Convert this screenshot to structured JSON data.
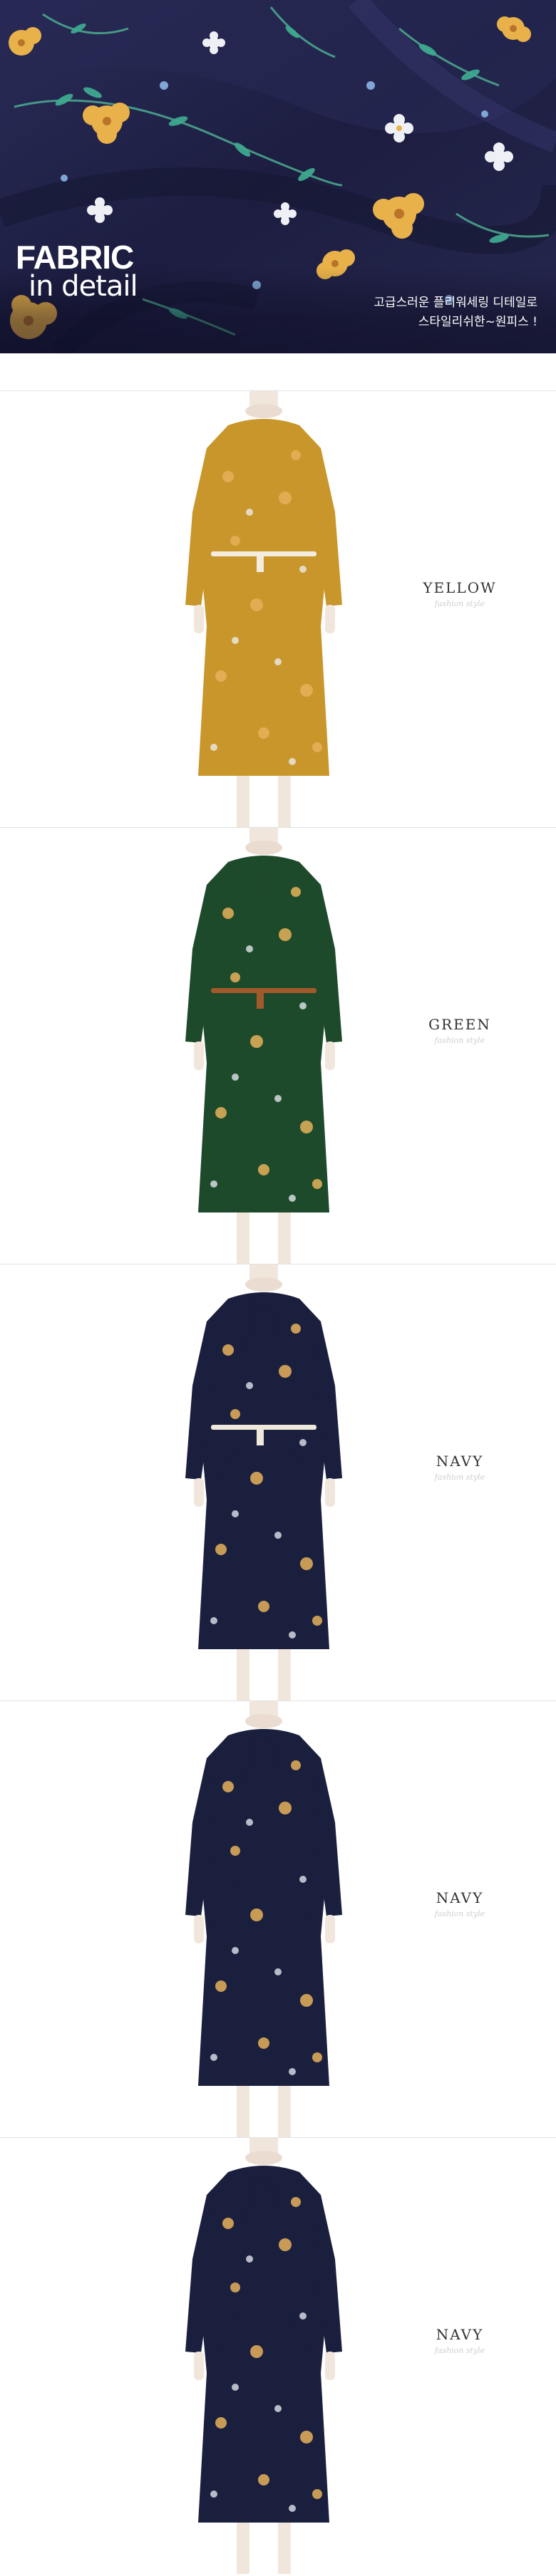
{
  "fabric": {
    "title_line1": "FABRIC",
    "title_line2": "in detail",
    "description": [
      "고급스러운 플리워세링 디테일로",
      "스타일리쉬한~원피스 !"
    ],
    "colors": {
      "base": "#1f2045",
      "flower_yellow": "#e9b14a",
      "flower_white": "#eef0f5",
      "leaf": "#3fa98f"
    }
  },
  "variants": [
    {
      "label": "YELLOW",
      "sub": "fashion style",
      "dress_color": "#c8962a",
      "belt_color": "#f3ecdf"
    },
    {
      "label": "GREEN",
      "sub": "fashion style",
      "dress_color": "#1e4a2c",
      "belt_color": "#a35a2a"
    },
    {
      "label": "NAVY",
      "sub": "fashion style",
      "dress_color": "#1b1f3e",
      "belt_color": "#efe9dc"
    },
    {
      "label": "NAVY",
      "sub": "fashion style",
      "dress_color": "#1b1f3e",
      "belt_color": ""
    },
    {
      "label": "NAVY",
      "sub": "fashion style",
      "dress_color": "#1b1f3e",
      "belt_color": ""
    }
  ]
}
